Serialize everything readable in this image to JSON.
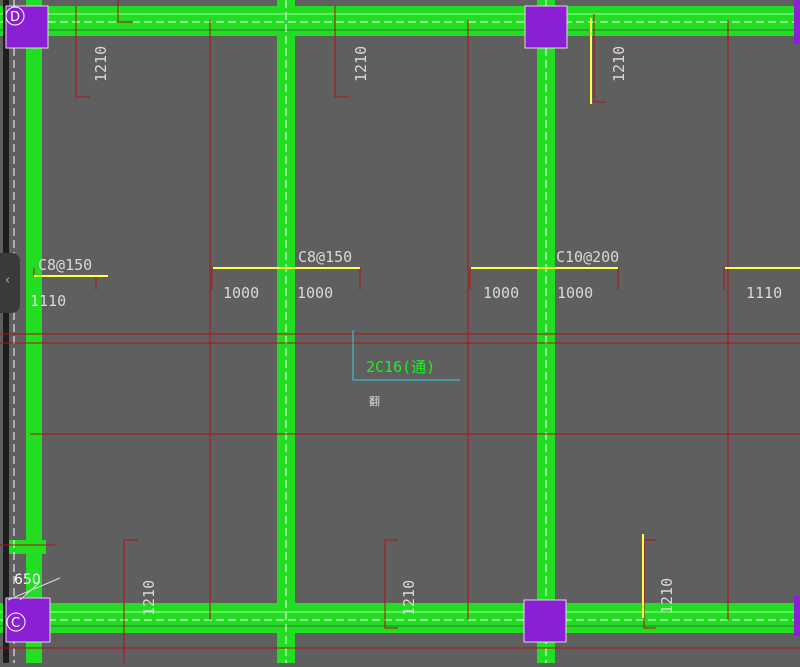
{
  "colors": {
    "background": "#5f5f5f",
    "beam": "#22dd22",
    "column": "#8a1fd6",
    "rebar_red": "#b01010",
    "rebar_yellow": "#ffff44",
    "annotation_cyan": "#33ccdd"
  },
  "grid_axes": [
    "D",
    "C"
  ],
  "rebar_labels": {
    "top_left_length": "1210",
    "top_middle_length": "1210",
    "top_right_length": "1210",
    "bottom_left_length": "1210",
    "bottom_middle_length": "1210",
    "bottom_right_length": "1210",
    "spec_left": "C8@150",
    "spec_middle": "C8@150",
    "spec_right": "C10@200",
    "len_left": "1110",
    "len_mid_a": "1000",
    "len_mid_b": "1000",
    "len_right_a": "1000",
    "len_right_b": "1000",
    "len_far_right": "1110"
  },
  "beam_annotation": {
    "reinforcement": "2C16(通)",
    "note": "翻"
  },
  "dimension": "650",
  "side_handle_icon": "chevron-left-icon"
}
